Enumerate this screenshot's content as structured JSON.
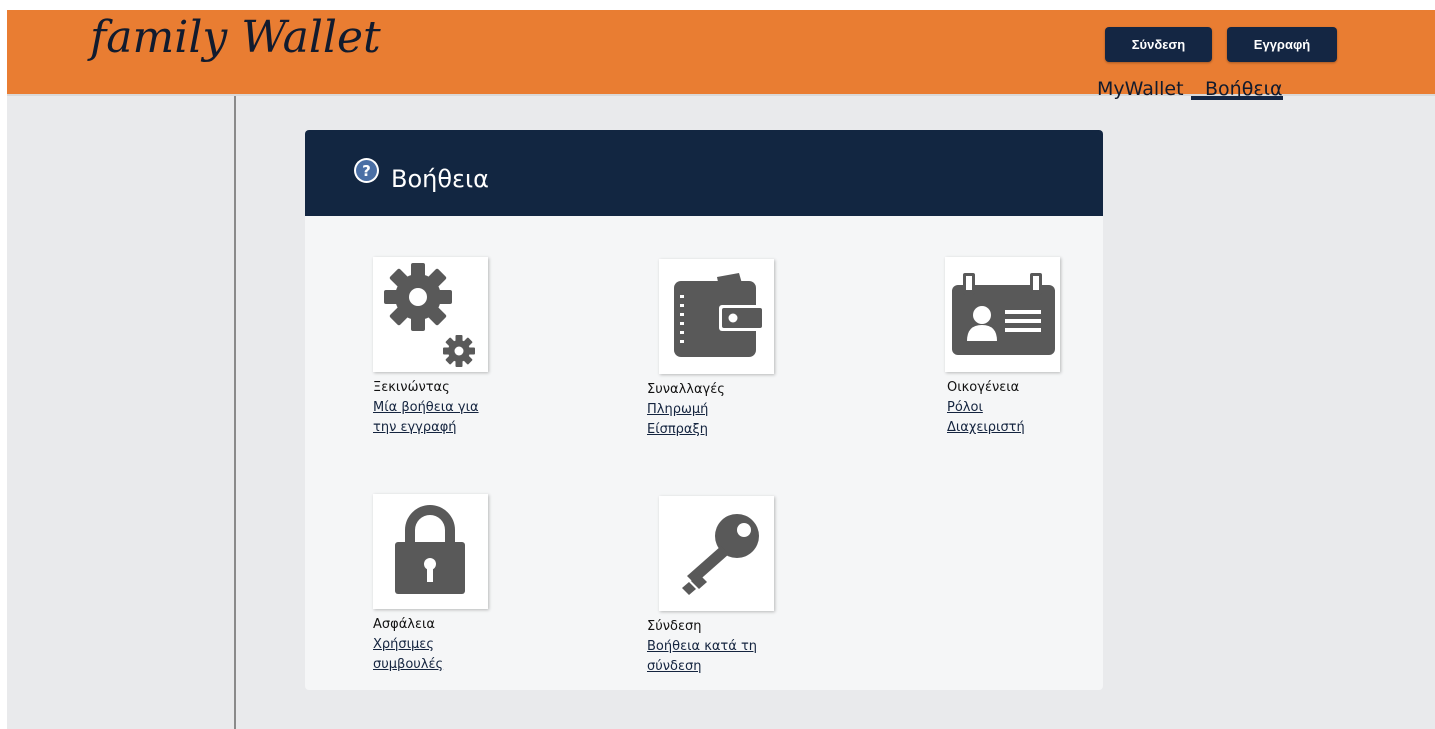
{
  "header": {
    "logo_text": "family Wallet",
    "login_label": "Σύνδεση",
    "register_label": "Εγγραφή",
    "nav": [
      {
        "label": "MyWallet"
      },
      {
        "label": "Βοήθεια",
        "active": true
      }
    ]
  },
  "panel": {
    "title": "Βοήθεια",
    "icon": "question-circle-icon"
  },
  "topics": [
    {
      "icon": "gears-icon",
      "title": "Ξεκινώντας",
      "links": [
        "Μία βοήθεια για",
        "την εγγραφή"
      ]
    },
    {
      "icon": "wallet-icon",
      "title": "Συναλλαγές",
      "links": [
        "Πληρωμή",
        "Είσπραξη"
      ]
    },
    {
      "icon": "id-card-icon",
      "title": "Οικογένεια",
      "links": [
        "Ρόλοι",
        "Διαχειριστή"
      ]
    },
    {
      "icon": "lock-icon",
      "title": "Ασφάλεια",
      "links": [
        "Χρήσιμες",
        "συμβουλές"
      ]
    },
    {
      "icon": "key-icon",
      "title": "Σύνδεση",
      "links": [
        "Βοήθεια κατά τη",
        "σύνδεση"
      ]
    }
  ],
  "colors": {
    "header_orange": "#e97d32",
    "navy": "#122641",
    "icon_gray": "#595959",
    "background": "#e9eaec"
  }
}
